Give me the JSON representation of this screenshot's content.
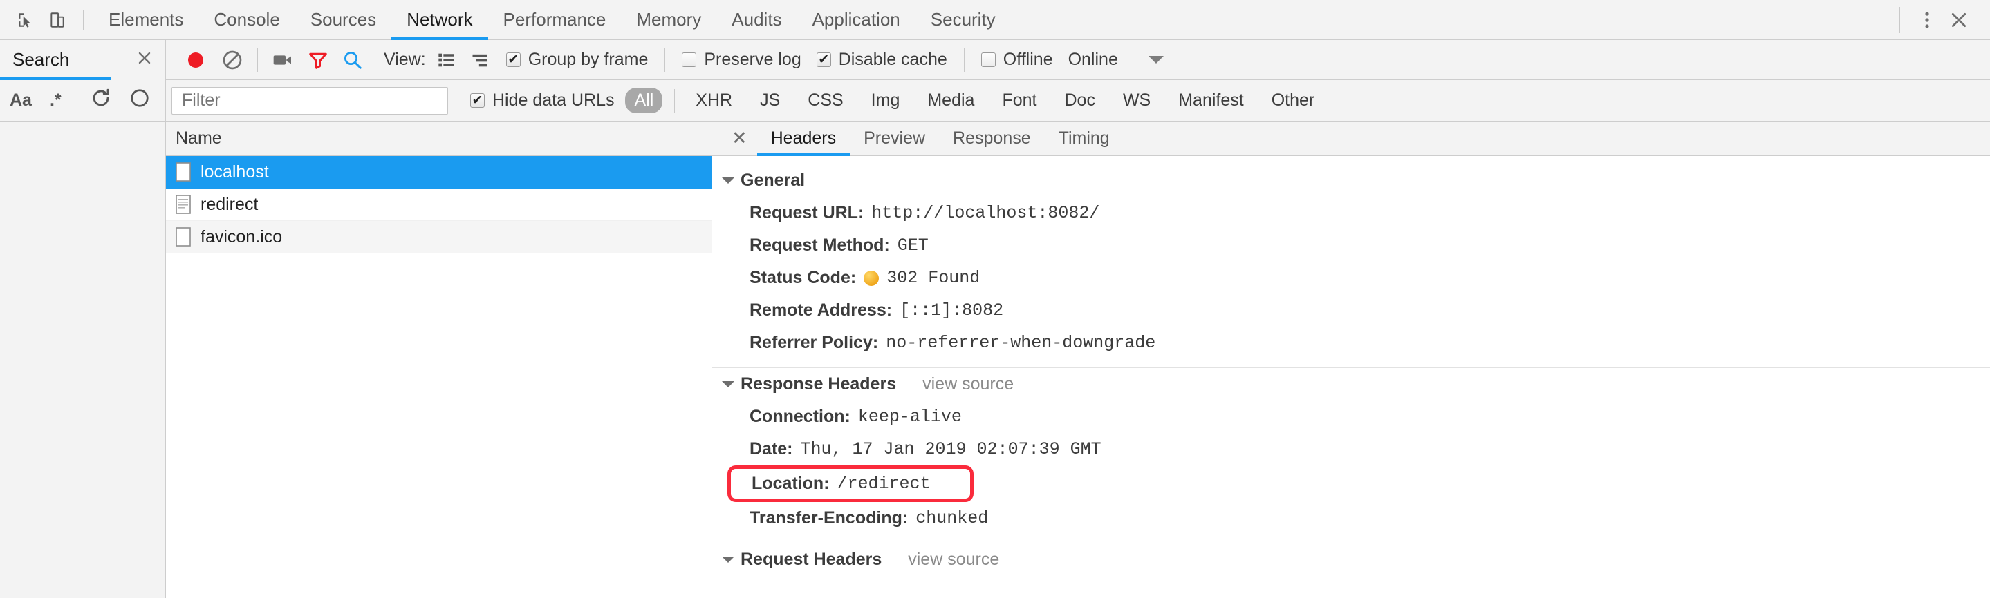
{
  "main_tabs": [
    {
      "label": "Elements",
      "active": false
    },
    {
      "label": "Console",
      "active": false
    },
    {
      "label": "Sources",
      "active": false
    },
    {
      "label": "Network",
      "active": true
    },
    {
      "label": "Performance",
      "active": false
    },
    {
      "label": "Memory",
      "active": false
    },
    {
      "label": "Audits",
      "active": false
    },
    {
      "label": "Application",
      "active": false
    },
    {
      "label": "Security",
      "active": false
    }
  ],
  "main_tabbar_icons": {
    "inspect": "inspect-element-icon",
    "device": "device-toolbar-icon",
    "menu": "more-options-icon",
    "close": "close-devtools-icon"
  },
  "search_panel": {
    "title": "Search",
    "close_icon": "close-icon",
    "tools": {
      "match_case": "Aa",
      "regex": ".*",
      "refresh": "refresh-icon",
      "clear": "clear-icon"
    }
  },
  "network_toolbar": {
    "record_icon": "record-button",
    "clear_icon": "clear-icon",
    "capture_screenshots_icon": "camera-icon",
    "filter_icon": "filter-icon",
    "search_icon": "search-icon",
    "view_label": "View:",
    "view_list_icon": "list-view-icon",
    "view_waterfall_icon": "waterfall-view-icon",
    "group_by_frame": {
      "label": "Group by frame",
      "checked": true,
      "mark": "✔"
    },
    "preserve_log": {
      "label": "Preserve log",
      "checked": false,
      "mark": ""
    },
    "disable_cache": {
      "label": "Disable cache",
      "checked": true,
      "mark": "✔"
    },
    "offline": {
      "label": "Offline",
      "checked": false,
      "mark": ""
    },
    "throttling": "Online",
    "throttling_caret": "chevron-down-icon"
  },
  "filter_bar": {
    "filter_placeholder": "Filter",
    "filter_value": "",
    "hide_data_urls": {
      "label": "Hide data URLs",
      "checked": true,
      "mark": "✔"
    },
    "types": [
      {
        "label": "All",
        "selected": true
      },
      {
        "label": "XHR",
        "selected": false
      },
      {
        "label": "JS",
        "selected": false
      },
      {
        "label": "CSS",
        "selected": false
      },
      {
        "label": "Img",
        "selected": false
      },
      {
        "label": "Media",
        "selected": false
      },
      {
        "label": "Font",
        "selected": false
      },
      {
        "label": "Doc",
        "selected": false
      },
      {
        "label": "WS",
        "selected": false
      },
      {
        "label": "Manifest",
        "selected": false
      },
      {
        "label": "Other",
        "selected": false
      }
    ]
  },
  "requests": {
    "column_header": "Name",
    "rows": [
      {
        "name": "localhost",
        "icon": "blank-document-icon",
        "selected": true
      },
      {
        "name": "redirect",
        "icon": "text-document-icon",
        "selected": false
      },
      {
        "name": "favicon.ico",
        "icon": "blank-document-icon",
        "selected": false
      }
    ]
  },
  "detail": {
    "close_icon": "close-icon",
    "tabs": [
      {
        "label": "Headers",
        "active": true
      },
      {
        "label": "Preview",
        "active": false
      },
      {
        "label": "Response",
        "active": false
      },
      {
        "label": "Timing",
        "active": false
      }
    ],
    "sections": [
      {
        "title": "General",
        "view_source": "",
        "rows": [
          {
            "key": "Request URL:",
            "value": "http://localhost:8082/"
          },
          {
            "key": "Request Method:",
            "value": "GET"
          },
          {
            "key": "Status Code:",
            "value": "302 Found",
            "status_dot": true,
            "dot_color": "#f0a81e"
          },
          {
            "key": "Remote Address:",
            "value": "[::1]:8082"
          },
          {
            "key": "Referrer Policy:",
            "value": "no-referrer-when-downgrade"
          }
        ]
      },
      {
        "title": "Response Headers",
        "view_source": "view source",
        "rows": [
          {
            "key": "Connection:",
            "value": "keep-alive"
          },
          {
            "key": "Date:",
            "value": "Thu, 17 Jan 2019 02:07:39 GMT"
          },
          {
            "key": "Location:",
            "value": "/redirect",
            "highlight": true
          },
          {
            "key": "Transfer-Encoding:",
            "value": "chunked"
          }
        ]
      },
      {
        "title": "Request Headers",
        "view_source": "view source",
        "rows": []
      }
    ]
  },
  "colors": {
    "accent_blue": "#1a9bf0",
    "toolbar_bg": "#f3f3f3",
    "annotation_red": "#fa2b3c",
    "record_red": "#ee3b30",
    "status_orange": "#f0a81e"
  }
}
